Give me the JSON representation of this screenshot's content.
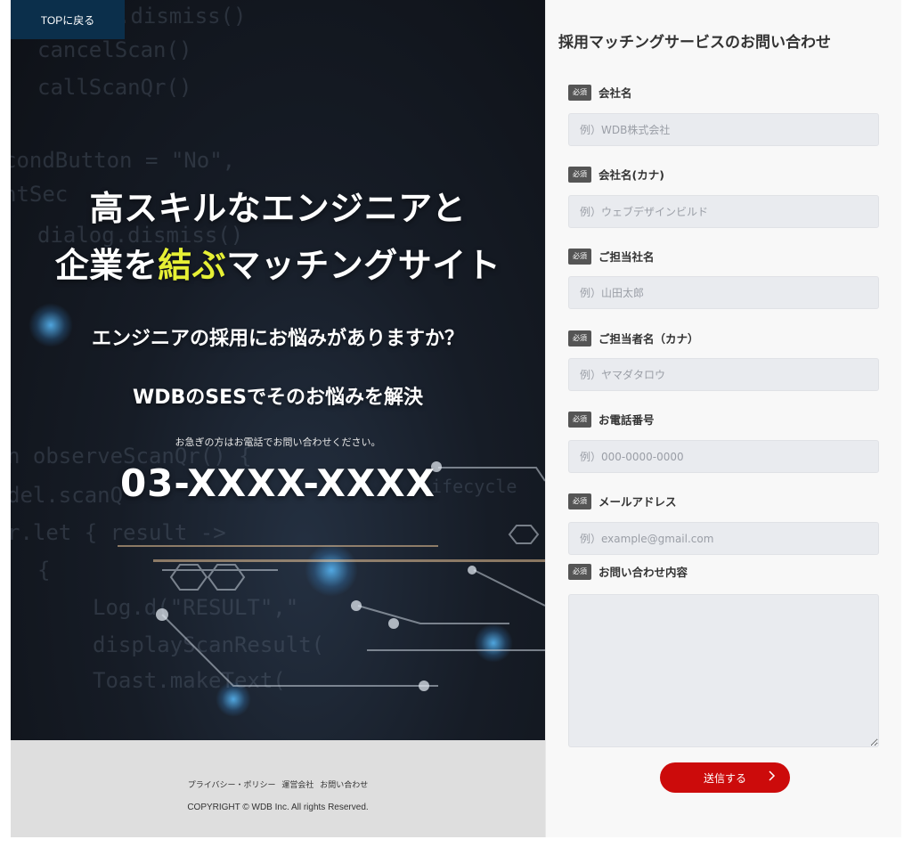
{
  "hero": {
    "back_link": "TOPに戻る",
    "title_line1": "高スキルなエンジニアと",
    "title_line2_pre": "企業を",
    "title_line2_highlight": "結ぶ",
    "title_line2_post": "マッチングサイト",
    "subtitle1": "エンジニアの採用にお悩みがありますか？",
    "subtitle2": "WDBのSESでそのお悩みを解決",
    "phone_note": "お急ぎの方はお電話でお問い合わせください。",
    "phone": "03-XXXX-XXXX",
    "highlight_color": "#e6f035",
    "code_lines": [
      ".dismiss()",
      "cancelScan()",
      "callScanQr()",
      "condButton = \"No\",",
      "ntSec",
      "dialog.dismiss()",
      "n observeScanQr() {",
      "del.scanQ",
      "r.let { result ->",
      "{",
      "Log.d(\"RESULT\",\"",
      "displayScanResult(",
      "Toast.makeText(",
      "lifecycle"
    ]
  },
  "footer": {
    "links": [
      "プライバシー・ポリシー",
      "運営会社",
      "お問い合わせ"
    ],
    "copyright": "COPYRIGHT © WDB Inc. All rights Reserved."
  },
  "form": {
    "title": "採用マッチングサービスのお問い合わせ",
    "required_badge": "必須",
    "fields": [
      {
        "label": "会社名",
        "placeholder": "例）WDB株式会社"
      },
      {
        "label": "会社名(カナ)",
        "placeholder": "例）ウェブデザインビルド"
      },
      {
        "label": "ご担当社名",
        "placeholder": "例）山田太郎"
      },
      {
        "label": "ご担当者名（カナ）",
        "placeholder": "例）ヤマダタロウ"
      },
      {
        "label": "お電話番号",
        "placeholder": "例）000-0000-0000"
      },
      {
        "label": "メールアドレス",
        "placeholder": "例）example@gmail.com"
      },
      {
        "label": "お問い合わせ内容",
        "placeholder": ""
      }
    ],
    "submit_label": "送信する",
    "submit_icon": "chevron-right-icon",
    "submit_color": "#cc0b0b"
  }
}
